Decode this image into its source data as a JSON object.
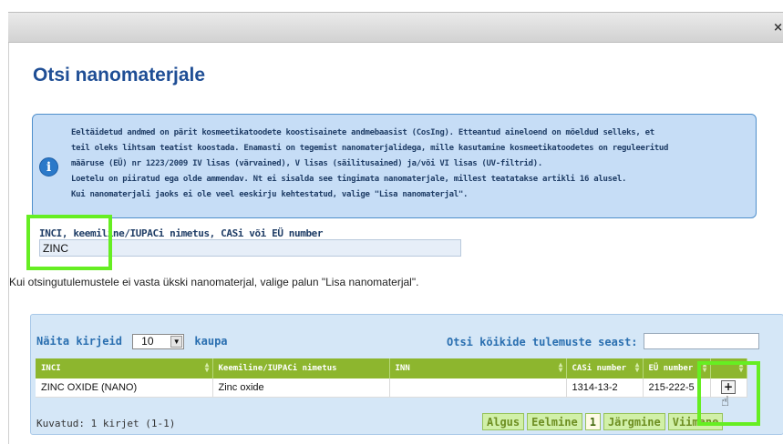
{
  "dialog": {
    "close_label": "×",
    "title": "Otsi nanomaterjale"
  },
  "info": {
    "line1": "Eeltäidetud andmed on pärit kosmeetikatoodete koostisainete andmebaasist (CosIng). Etteantud aineloend on mõeldud selleks, et",
    "line2": "teil oleks lihtsam teatist koostada. Enamasti on tegemist nanomaterjalidega, mille kasutamine kosmeetikatoodetes on reguleeritud",
    "line3": "määruse (EÜ) nr 1223/2009 IV lisas (värvained), V lisas (säilitusained) ja/või VI lisas (UV-filtrid).",
    "line4": "Loetelu on piiratud ega olde ammendav. Nt ei sisalda see tingimata nanomaterjale, millest teatatakse artikli 16 alusel.",
    "line5": "Kui nanomaterjali jaoks ei ole veel eeskirju kehtestatud, valige \"Lisa nanomaterjal\"."
  },
  "search": {
    "label": "INCI, keemiline/IUPACi nimetus, CASi või EÜ number",
    "value": "ZINC"
  },
  "no_results_text": "Kui otsingutulemustele ei vasta ükski nanomaterjal, valige palun \"Lisa nanomaterjal\".",
  "table": {
    "show_label": "Näita kirjeid",
    "page_size": "10",
    "per_page_label": "kaupa",
    "filter_label": "Otsi kõikide tulemuste seast:",
    "columns": [
      "INCI",
      "Keemiline/IUPACi nimetus",
      "INN",
      "CASi number",
      "EÜ number",
      ""
    ],
    "rows": [
      [
        "ZINC OXIDE (NANO)",
        "Zinc oxide",
        "",
        "1314-13-2",
        "215-222-5",
        "+"
      ]
    ],
    "count_text": "Kuvatud: 1 kirjet (1-1)",
    "pager": [
      "Algus",
      "Eelmine",
      "1",
      "Järgmine",
      "Viimane"
    ]
  }
}
